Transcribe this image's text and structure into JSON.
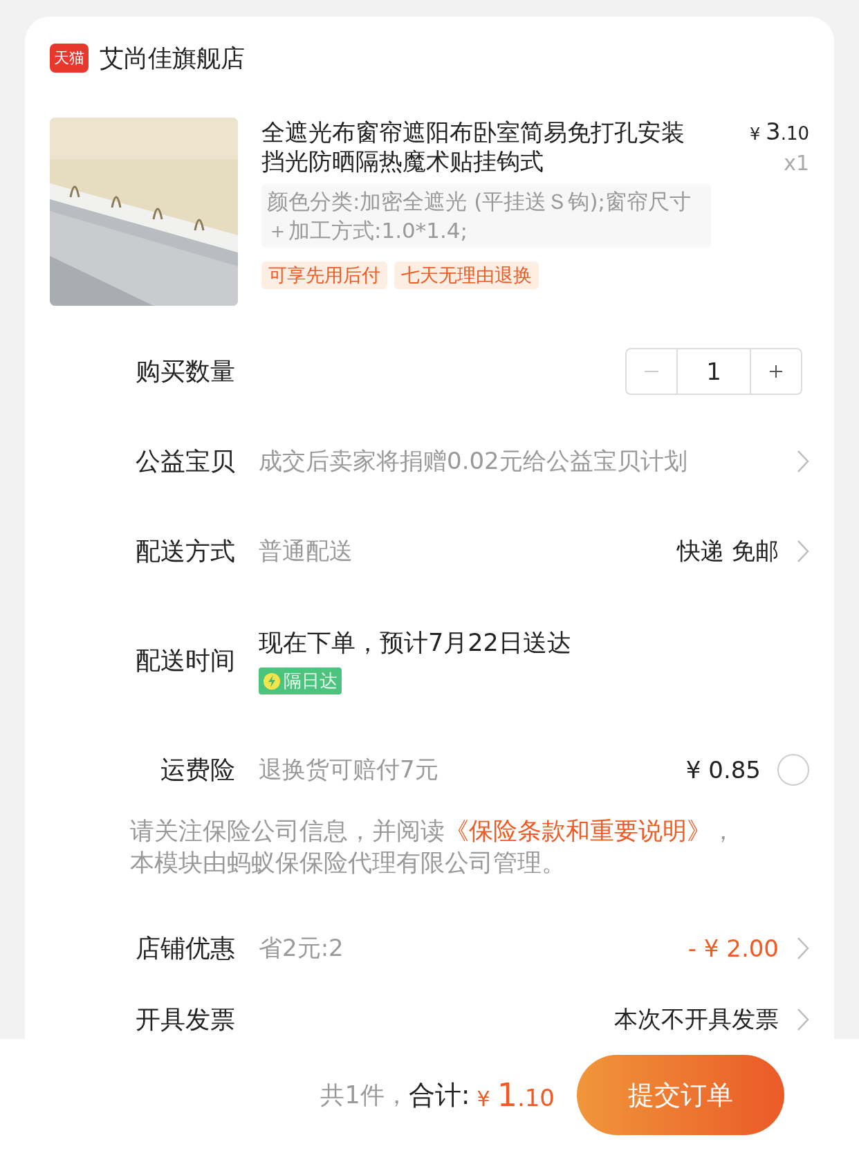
{
  "store": {
    "badge": "天猫",
    "name": "艾尚佳旗舰店"
  },
  "product": {
    "kind": "picture",
    "title": "全遮光布窗帘遮阳布卧室简易免打孔安装挡光防晒隔热魔术贴挂钩式",
    "price_symbol": "¥",
    "price_int": "3",
    "price_dec": ".10",
    "quantity": "x1",
    "sku": "颜色分类:加密全遮光 (平挂送Ｓ钩);窗帘尺寸＋加工方式:1.0*1.4;",
    "tags": [
      "可享先用后付",
      "七天无理由退换"
    ]
  },
  "quantity_row": {
    "label": "购买数量",
    "value": "1",
    "minus_disabled": true,
    "plus_disabled": false
  },
  "charity": {
    "label": "公益宝贝",
    "value": "成交后卖家将捐赠0.02元给公益宝贝计划"
  },
  "shipping": {
    "label": "配送方式",
    "value": "普通配送",
    "detail": "快递 免邮"
  },
  "delivery_time": {
    "label": "配送时间",
    "value": "现在下单，预计7月22日送达",
    "badge": "隔日达"
  },
  "insurance": {
    "label": "运费险",
    "value": "退换货可赔付7元",
    "price": "¥ 0.85",
    "checked": false
  },
  "notice": {
    "before": "请关注保险公司信息，并阅读",
    "link": "《保险条款和重要说明》",
    "after": "，本模块由蚂蚁保保险代理有限公司管理。"
  },
  "discount": {
    "label": "店铺优惠",
    "value": "省2元:2",
    "amount": "- ¥ 2.00"
  },
  "invoice": {
    "label": "开具发票",
    "value": "本次不开具发票"
  },
  "footer": {
    "count": "共1件，",
    "total_label": "合计:",
    "currency": "¥",
    "total_int": "1",
    "total_dec": ".10",
    "submit": "提交订单"
  }
}
